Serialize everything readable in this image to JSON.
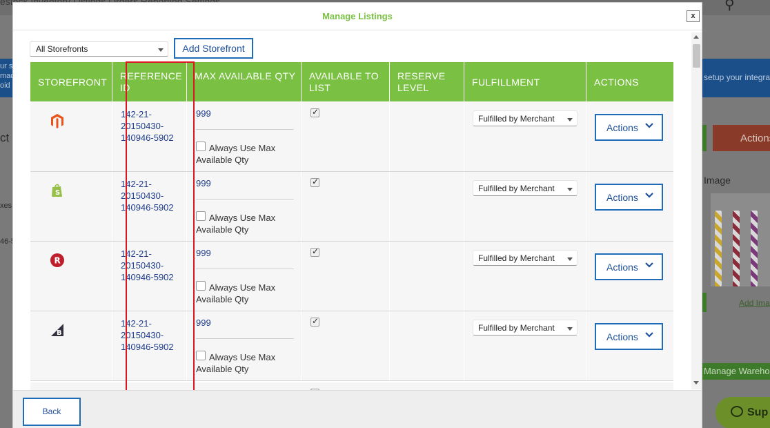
{
  "background": {
    "nav_text": "estock   Inventory   Listings   Orders   Reporting   Settings",
    "left_snippets": [
      "ur s",
      "mad",
      "oid",
      "ct",
      "xes",
      "46-5"
    ],
    "bluebar_text": "setup your integra",
    "actions_label": "Actions",
    "image_label": "Image",
    "add_image_link": "Add Ima",
    "manage_warehouse": "Manage Wareho",
    "support_label": "Sup"
  },
  "modal": {
    "title": "Manage Listings",
    "close_label": "x",
    "storefront_filter": "All Storefronts",
    "add_storefront_label": "Add Storefront",
    "back_label": "Back"
  },
  "columns": [
    {
      "label": "STOREFRONT"
    },
    {
      "label": "REFERENCE ID"
    },
    {
      "label": "MAX AVAILABLE QTY"
    },
    {
      "label": "AVAILABLE TO LIST"
    },
    {
      "label": "RESERVE LEVEL"
    },
    {
      "label": "FULFILLMENT"
    },
    {
      "label": "ACTIONS"
    }
  ],
  "rows": [
    {
      "storefront_icon": "magento-icon",
      "ref_id": "142-21-20150430-140946-5902",
      "max_qty": "999",
      "always_label": "Always Use Max Available Qty",
      "always_checked": false,
      "available": true,
      "reserve": "",
      "fulfillment": "Fulfilled by Merchant",
      "actions_label": "Actions"
    },
    {
      "storefront_icon": "shopify-icon",
      "ref_id": "142-21-20150430-140946-5902",
      "max_qty": "999",
      "always_label": "Always Use Max Available Qty",
      "always_checked": false,
      "available": true,
      "reserve": "",
      "fulfillment": "Fulfilled by Merchant",
      "actions_label": "Actions"
    },
    {
      "storefront_icon": "rakuten-icon",
      "ref_id": "142-21-20150430-140946-5902",
      "max_qty": "999",
      "always_label": "Always Use Max Available Qty",
      "always_checked": false,
      "available": true,
      "reserve": "",
      "fulfillment": "Fulfilled by Merchant",
      "actions_label": "Actions"
    },
    {
      "storefront_icon": "bigcommerce-icon",
      "ref_id": "142-21-20150430-140946-5902",
      "max_qty": "999",
      "always_label": "Always Use Max Available Qty",
      "always_checked": false,
      "available": true,
      "reserve": "",
      "fulfillment": "Fulfilled by Merchant",
      "actions_label": "Actions"
    }
  ],
  "colors": {
    "header_green": "#7ac143",
    "link_blue": "#1e3c8a",
    "button_border": "#1e6bb8",
    "highlight_red": "#e0141c"
  }
}
